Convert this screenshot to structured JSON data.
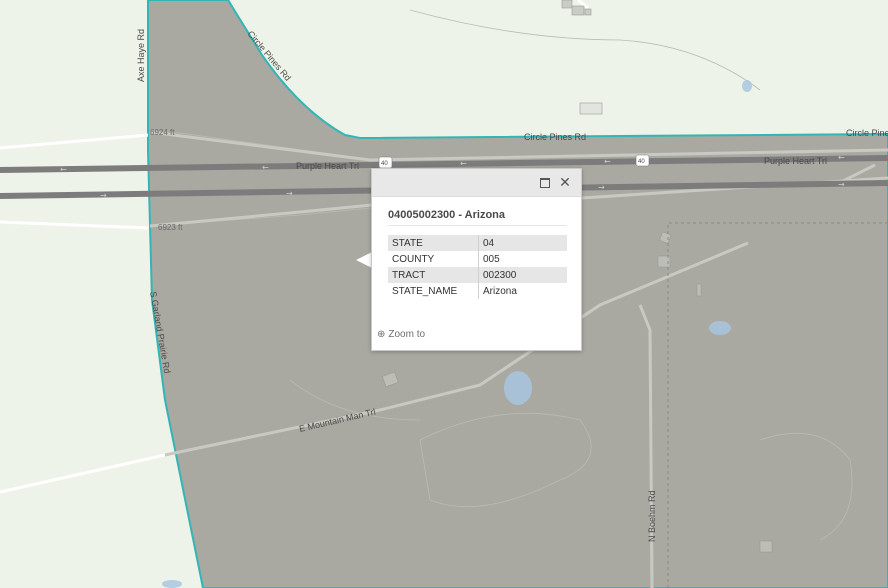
{
  "map": {
    "colors": {
      "background": "#eef3ea",
      "tract_fill": "#a9a9a1",
      "tract_outline": "#33b5b5",
      "highway": "#7c7c7c",
      "road": "#c9c9c4",
      "water": "#a8c6df"
    },
    "labels": {
      "road_circle_pines_1": "Circle Pines Rd",
      "road_circle_pines_2": "Circle Pines Rd",
      "road_circle_pines_3": "Circle Pine",
      "road_axe_haye": "Axe Haye Rd",
      "road_purple_heart_1": "Purple Heart Trl",
      "road_purple_heart_2": "Purple Heart Trl",
      "contour_6924": "6924 ft",
      "contour_6923": "6923 ft",
      "shield_40_a": "40",
      "shield_40_b": "40",
      "road_garland_prairie": "S Garland Prairie Rd",
      "road_mountain_man": "E Mountain Man Trl",
      "road_boehm": "N Boehm Rd"
    }
  },
  "popup": {
    "title": "04005002300 - Arizona",
    "maximize_icon": "maximize-icon",
    "close_icon": "close-icon",
    "close_glyph": "✕",
    "attributes": [
      {
        "key": "STATE",
        "value": "04"
      },
      {
        "key": "COUNTY",
        "value": "005"
      },
      {
        "key": "TRACT",
        "value": "002300"
      },
      {
        "key": "STATE_NAME",
        "value": "Arizona"
      }
    ],
    "zoom_label": "Zoom to",
    "zoom_icon": "magnifier-plus-icon",
    "zoom_glyph": "⊕"
  }
}
